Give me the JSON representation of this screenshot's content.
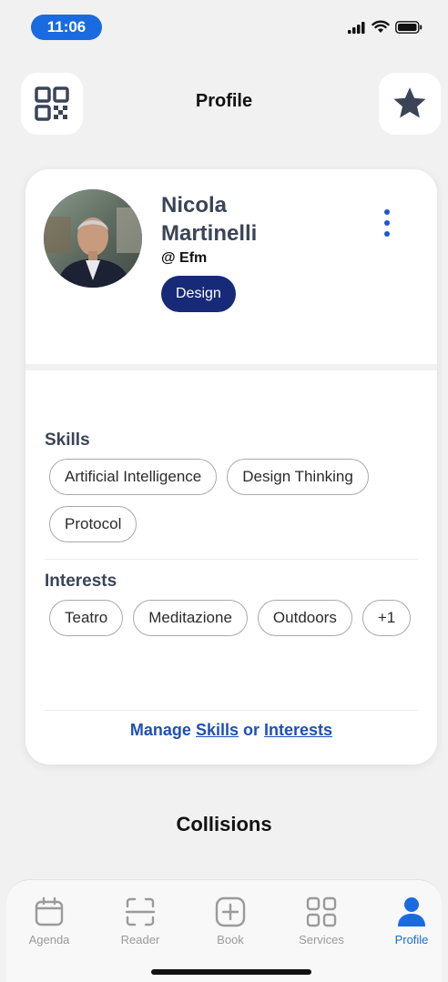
{
  "status_bar": {
    "time": "11:06",
    "icons": [
      "signal-icon",
      "wifi-icon",
      "battery-icon"
    ]
  },
  "header": {
    "title": "Profile",
    "left_icon": "qr-code-icon",
    "right_icon": "star-icon"
  },
  "profile": {
    "name_line1": "Nicola",
    "name_line2": "Martinelli",
    "handle": "@ Efm",
    "role": "Design"
  },
  "skills": {
    "title": "Skills",
    "items": [
      "Artificial Intelligence",
      "Design Thinking",
      "Protocol"
    ]
  },
  "interests": {
    "title": "Interests",
    "items": [
      "Teatro",
      "Meditazione",
      "Outdoors",
      "+1"
    ]
  },
  "manage": {
    "prefix": "Manage",
    "skills_link": "Skills",
    "or": "or",
    "interests_link": "Interests"
  },
  "collisions": {
    "title": "Collisions"
  },
  "tabs": [
    {
      "label": "Agenda",
      "icon": "calendar-icon",
      "active": false
    },
    {
      "label": "Reader",
      "icon": "scan-icon",
      "active": false
    },
    {
      "label": "Book",
      "icon": "plus-square-icon",
      "active": false
    },
    {
      "label": "Services",
      "icon": "grid-icon",
      "active": false
    },
    {
      "label": "Profile",
      "icon": "person-icon",
      "active": true
    }
  ],
  "colors": {
    "accent": "#1a6be0",
    "badge": "#172a78",
    "link": "#1f4fb8",
    "heading": "#3b4457"
  }
}
